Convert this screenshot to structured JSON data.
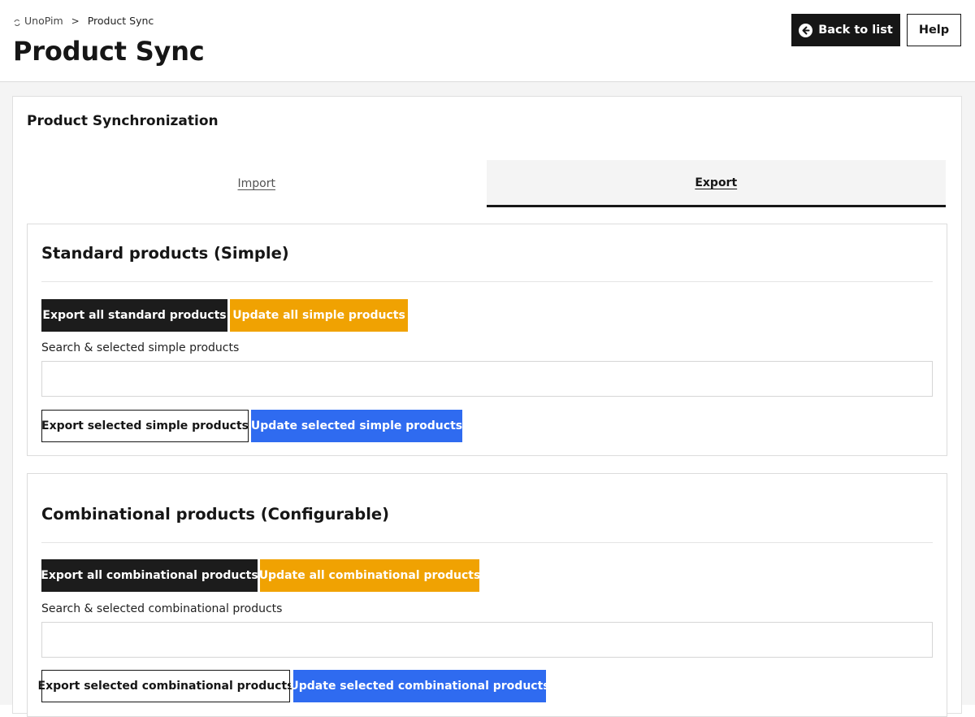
{
  "header": {
    "breadcrumb": {
      "root_icon": "sync-icon",
      "root": "UnoPim",
      "separator": ">",
      "current": "Product Sync"
    },
    "title": "Product Sync",
    "back_label": "Back to list",
    "back_icon": "arrow-left-circle-icon",
    "help_label": "Help"
  },
  "card": {
    "title": "Product Synchronization",
    "tabs": [
      {
        "label": "Import",
        "active": false
      },
      {
        "label": "Export",
        "active": true
      }
    ]
  },
  "sections": {
    "simple": {
      "title": "Standard products (Simple)",
      "export_all_label": "Export all standard products",
      "update_all_label": "Update all simple products",
      "search_label": "Search & selected simple products",
      "search_value": "",
      "export_selected_label": "Export selected simple products",
      "update_selected_label": "Update selected simple products"
    },
    "configurable": {
      "title": "Combinational products (Configurable)",
      "export_all_label": "Export all combinational products",
      "update_all_label": "Update all combinational products",
      "search_label": "Search & selected combinational products",
      "search_value": "",
      "export_selected_label": "Export selected combinational products",
      "update_selected_label": "Update selected combinational products"
    }
  },
  "colors": {
    "dark": "#1c1c1c",
    "orange": "#f0a202",
    "blue": "#2f6bf0"
  }
}
